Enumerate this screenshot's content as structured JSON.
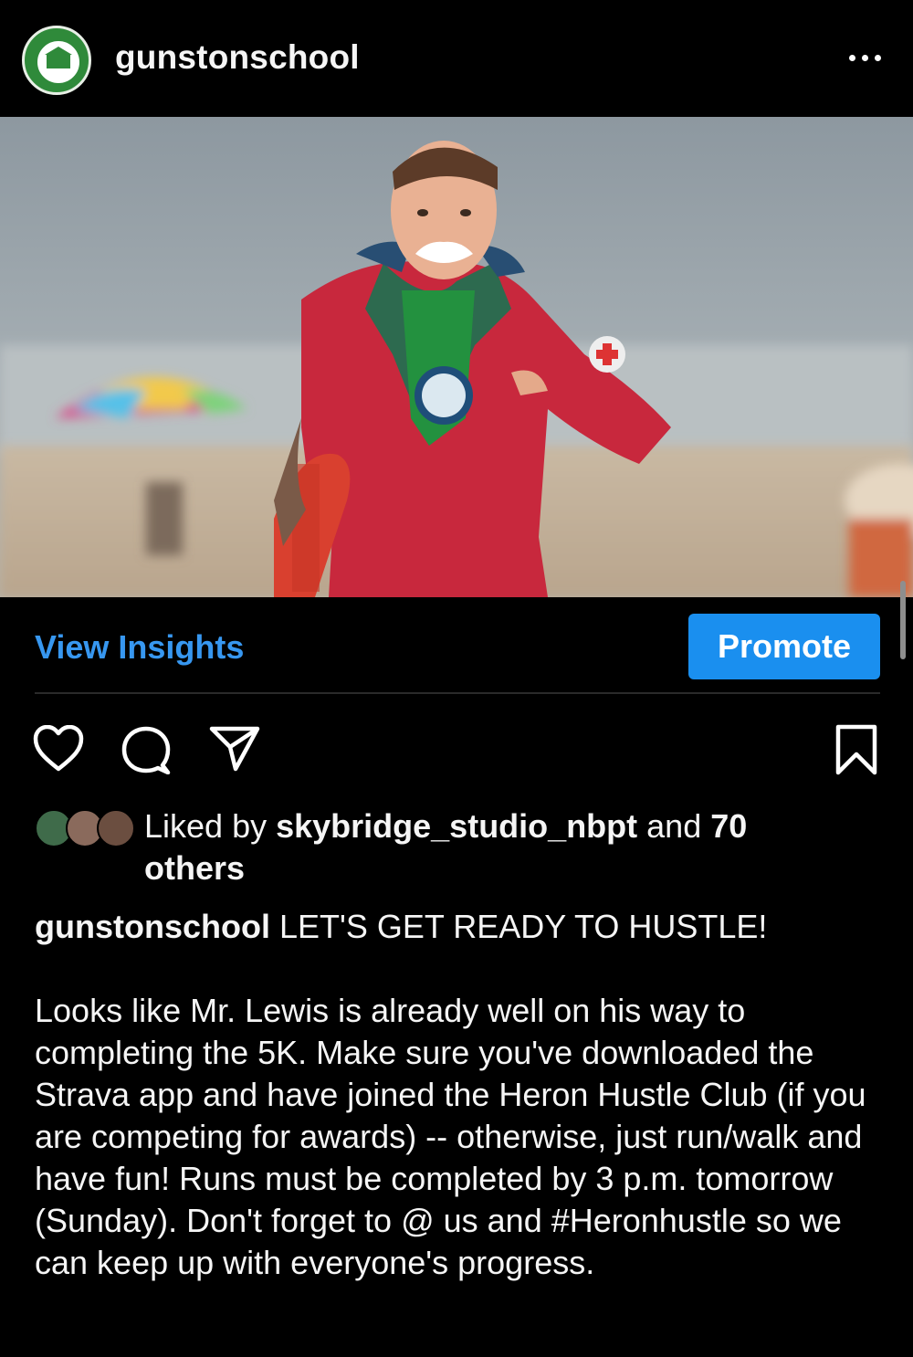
{
  "post": {
    "username": "gunstonschool",
    "view_insights_label": "View Insights",
    "promote_label": "Promote",
    "likes": {
      "prefix": "Liked by ",
      "user": "skybridge_studio_nbpt",
      "middle": " and ",
      "count": "70",
      "suffix": "others"
    },
    "caption": {
      "username": "gunstonschool",
      "headline": "LET'S GET READY TO HUSTLE!",
      "body": "Looks like Mr. Lewis is already well on his way to completing the 5K. Make sure you've downloaded the Strava app and have joined the Heron Hustle Club (if you are competing for awards) -- otherwise, just run/walk and have fun! Runs must be completed by 3 p.m. tomorrow (Sunday). Don't forget to @ us and #Heronhustle so we can keep up with everyone's progress."
    }
  },
  "icons": {
    "more": "more-horizontal-icon",
    "like": "heart-icon",
    "comment": "comment-icon",
    "share": "share-icon",
    "save": "bookmark-icon"
  },
  "colors": {
    "background": "#000000",
    "link": "#3797f0",
    "button": "#1a8fef",
    "school_green": "#2f8a3a"
  }
}
